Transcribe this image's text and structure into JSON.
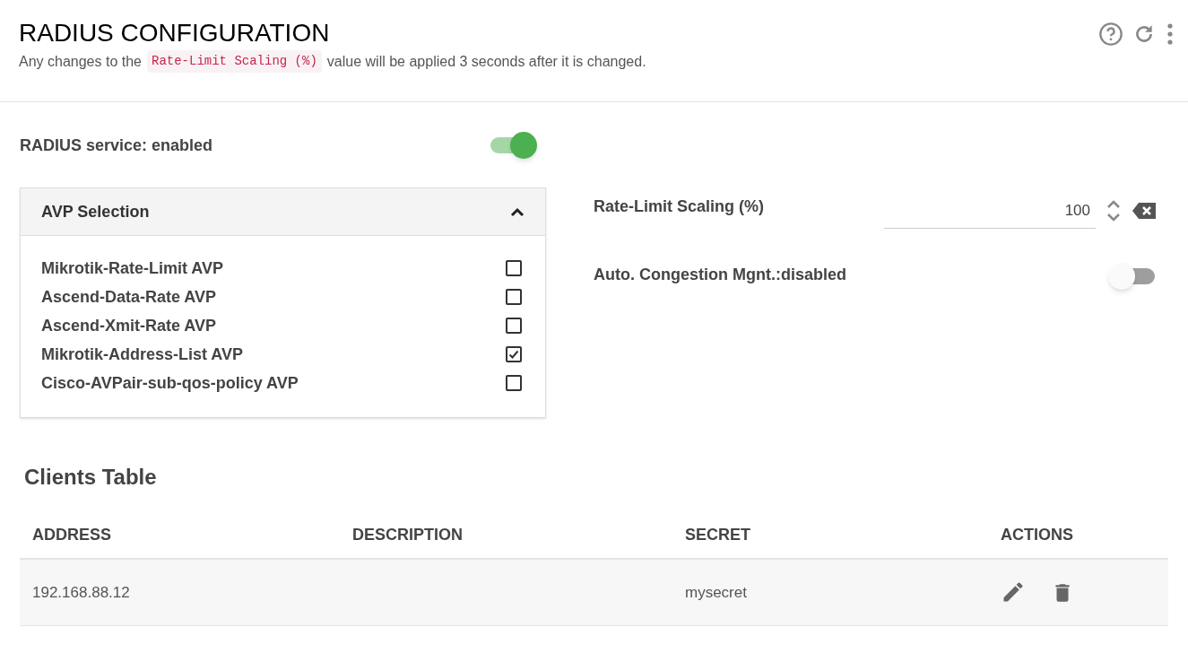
{
  "header": {
    "title": "RADIUS CONFIGURATION",
    "note_before": "Any changes to the",
    "note_code": "Rate-Limit Scaling (%)",
    "note_after": "value will be applied 3 seconds after it is changed."
  },
  "service": {
    "label": "RADIUS service: enabled",
    "on": true
  },
  "avp": {
    "title": "AVP Selection",
    "expanded": true,
    "items": [
      {
        "label": "Mikrotik-Rate-Limit AVP",
        "checked": false
      },
      {
        "label": "Ascend-Data-Rate AVP",
        "checked": false
      },
      {
        "label": "Ascend-Xmit-Rate AVP",
        "checked": false
      },
      {
        "label": "Mikrotik-Address-List AVP",
        "checked": true
      },
      {
        "label": "Cisco-AVPair-sub-qos-policy AVP",
        "checked": false
      }
    ]
  },
  "scaling": {
    "label": "Rate-Limit Scaling (%)",
    "value": "100"
  },
  "congestion": {
    "label": "Auto. Congestion Mgnt.:disabled",
    "on": false
  },
  "clients": {
    "title": "Clients Table",
    "columns": [
      "ADDRESS",
      "DESCRIPTION",
      "SECRET",
      "ACTIONS"
    ],
    "rows": [
      {
        "address": "192.168.88.12",
        "description": "",
        "secret": "mysecret"
      }
    ]
  }
}
